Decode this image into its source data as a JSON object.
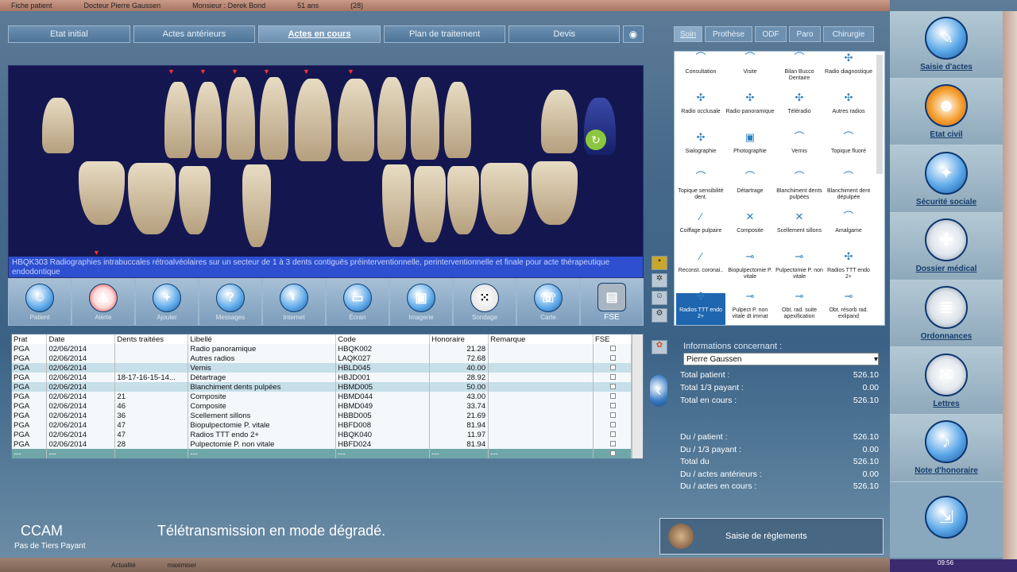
{
  "titlebar": {
    "app": "Fiche patient",
    "doctor": "Docteur Pierre Gaussen",
    "patient": "Monsieur : Derek Bond",
    "age": "51 ans",
    "id": "(28)"
  },
  "top_tabs": [
    "Etat initial",
    "Actes antérieurs",
    "Actes en cours",
    "Plan de traitement",
    "Devis"
  ],
  "active_top_tab": 2,
  "dental_caption": "HBQK303 Radiographies intrabuccales rétroalvéolaires sur un secteur de 1 à 3 dents contiguës préinterventionnelle, perinterventionnelle et finale pour acte thérapeutique endodontique",
  "toolbar": [
    {
      "icon": "user-icon",
      "label": "Patient"
    },
    {
      "icon": "warning-icon",
      "label": "Alerte"
    },
    {
      "icon": "plus-icon",
      "label": "Ajouter"
    },
    {
      "icon": "help-icon",
      "label": "Messages"
    },
    {
      "icon": "globe-icon",
      "label": "Internet"
    },
    {
      "icon": "monitor-icon",
      "label": "Écran"
    },
    {
      "icon": "camera-icon",
      "label": "Imagerie"
    },
    {
      "icon": "dice-icon",
      "label": "Sondage"
    },
    {
      "icon": "phone-icon",
      "label": "Carte"
    },
    {
      "icon": "fse-icon",
      "label": "FSE"
    }
  ],
  "table": {
    "headers": [
      "Prat",
      "Date",
      "Dents traitées",
      "Libellé",
      "Code",
      "Honoraire",
      "Remarque",
      "FSE"
    ],
    "rows": [
      {
        "prat": "PGA",
        "date": "02/06/2014",
        "dents": "",
        "libelle": "Radio panoramique",
        "code": "HBQK002",
        "honoraire": "21.28",
        "remarque": "",
        "style": "row-a"
      },
      {
        "prat": "PGA",
        "date": "02/06/2014",
        "dents": "",
        "libelle": "Autres radios",
        "code": "LAQK027",
        "honoraire": "72.68",
        "remarque": "",
        "style": "row-a"
      },
      {
        "prat": "PGA",
        "date": "02/06/2014",
        "dents": "",
        "libelle": "Vernis",
        "code": "HBLD045",
        "honoraire": "40.00",
        "remarque": "",
        "style": "row-b"
      },
      {
        "prat": "PGA",
        "date": "02/06/2014",
        "dents": "18-17-16-15-14...",
        "libelle": "Détartrage",
        "code": "HBJD001",
        "honoraire": "28.92",
        "remarque": "",
        "style": "row-a"
      },
      {
        "prat": "PGA",
        "date": "02/06/2014",
        "dents": "",
        "libelle": "Blanchiment dents pulpées",
        "code": "HBMD005",
        "honoraire": "50.00",
        "remarque": "",
        "style": "row-b"
      },
      {
        "prat": "PGA",
        "date": "02/06/2014",
        "dents": "21",
        "libelle": "Composite",
        "code": "HBMD044",
        "honoraire": "43.00",
        "remarque": "",
        "style": "row-a"
      },
      {
        "prat": "PGA",
        "date": "02/06/2014",
        "dents": "46",
        "libelle": "Composite",
        "code": "HBMD049",
        "honoraire": "33.74",
        "remarque": "",
        "style": "row-a"
      },
      {
        "prat": "PGA",
        "date": "02/06/2014",
        "dents": "36",
        "libelle": "Scellement sillons",
        "code": "HBBD005",
        "honoraire": "21.69",
        "remarque": "",
        "style": "row-a"
      },
      {
        "prat": "PGA",
        "date": "02/06/2014",
        "dents": "47",
        "libelle": "Biopulpectomie P. vitale",
        "code": "HBFD008",
        "honoraire": "81.94",
        "remarque": "",
        "style": "row-a"
      },
      {
        "prat": "PGA",
        "date": "02/06/2014",
        "dents": "47",
        "libelle": "Radios TTT endo 2+",
        "code": "HBQK040",
        "honoraire": "11.97",
        "remarque": "",
        "style": "row-a"
      },
      {
        "prat": "PGA",
        "date": "02/06/2014",
        "dents": "28",
        "libelle": "Pulpectomie P. non vitale",
        "code": "HBFD024",
        "honoraire": "81.94",
        "remarque": "",
        "style": "row-a"
      },
      {
        "prat": "---",
        "date": "---",
        "dents": "",
        "libelle": "---",
        "code": "---",
        "honoraire": "---",
        "remarque": "---",
        "style": "row-end"
      }
    ]
  },
  "bottom": {
    "ccam": "CCAM",
    "tiers": "Pas de Tiers Payant",
    "teletrans": "Télétransmission en mode dégradé.",
    "strip_left": "Actualité",
    "strip_right": "maximiser"
  },
  "right_tabs": [
    "Soin",
    "Prothèse",
    "ODF",
    "Paro",
    "Chirurgie"
  ],
  "active_right_tab": 0,
  "acts": [
    "Consultation",
    "Visite",
    "Bilan Bucco Dentaire",
    "Radio diagnostique",
    "Radio occlusale",
    "Radio panoramique",
    "Téléradio",
    "Autres radios",
    "Sialographie",
    "Photographie",
    "Vernis",
    "Topique fluoré",
    "Topique sensibilité dent.",
    "Détartrage",
    "Blanchiment dents pulpées",
    "Blanchiment dent dépulpée",
    "Coiffage pulpaire",
    "Composite",
    "Scellement sillons",
    "Amalgame",
    "Reconst. coronai..",
    "Biopulpectomie P. vitale",
    "Pulpectomie P. non vitale",
    "Radios TTT endo 2+",
    "Radios TTT endo 2+",
    "Pulpect P. non vitale dt immat",
    "Obt. rad. suite apexification",
    "Obt. résorb rad. exlipand"
  ],
  "selected_act": 24,
  "info": {
    "heading": "Informations concernant :",
    "patient": "Pierre Gaussen",
    "rows": [
      {
        "label": "Total patient :",
        "value": "526.10"
      },
      {
        "label": "Total 1/3 payant :",
        "value": "0.00"
      },
      {
        "label": "Total en cours :",
        "value": "526.10"
      },
      {
        "label": "Du / patient :",
        "value": "526.10"
      },
      {
        "label": "Du / 1/3 payant :",
        "value": "0.00"
      },
      {
        "label": "Total du",
        "value": "526.10"
      },
      {
        "label": "Du / actes antérieurs :",
        "value": "0.00"
      },
      {
        "label": "Du / actes en cours :",
        "value": "526.10"
      }
    ]
  },
  "reglements": "Saisie de règlements",
  "sidebar": [
    {
      "icon": "act-entry-icon",
      "label": "Saisie d'actes"
    },
    {
      "icon": "civil-state-icon",
      "label": "Etat civil"
    },
    {
      "icon": "social-security-icon",
      "label": "Sécurité sociale"
    },
    {
      "icon": "medical-file-icon",
      "label": "Dossier médical"
    },
    {
      "icon": "prescription-icon",
      "label": "Ordonnances"
    },
    {
      "icon": "letters-icon",
      "label": "Lettres"
    },
    {
      "icon": "fee-note-icon",
      "label": "Note d'honoraire"
    }
  ],
  "taskbar_time": "09:56"
}
